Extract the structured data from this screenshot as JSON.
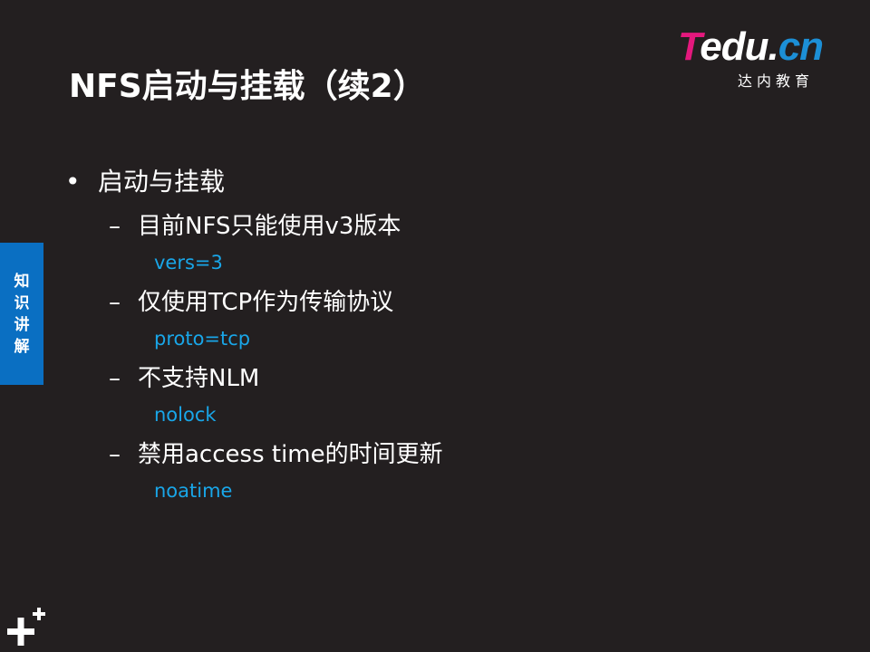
{
  "logo": {
    "mark_t": "T",
    "mark_rest": "edu.",
    "mark_cn": "cn",
    "subtitle": "达内教育"
  },
  "title": "NFS启动与挂载（续2）",
  "side_tab": {
    "label": "知识讲解"
  },
  "bullet": {
    "symbol": "•",
    "text": "启动与挂载",
    "dash_symbol": "–",
    "items": [
      {
        "text": "目前NFS只能使用v3版本",
        "code": "vers=3"
      },
      {
        "text": "仅使用TCP作为传输协议",
        "code": "proto=tcp"
      },
      {
        "text": "不支持NLM",
        "code": "nolock"
      },
      {
        "text": "禁用access time的时间更新",
        "code": "noatime"
      }
    ]
  },
  "colors": {
    "background": "#231f20",
    "accent_blue": "#19a6e8",
    "tab_blue": "#0a6fc2",
    "logo_pink": "#e4187d"
  },
  "icons": {
    "corner": "plus-decoration-icon"
  }
}
